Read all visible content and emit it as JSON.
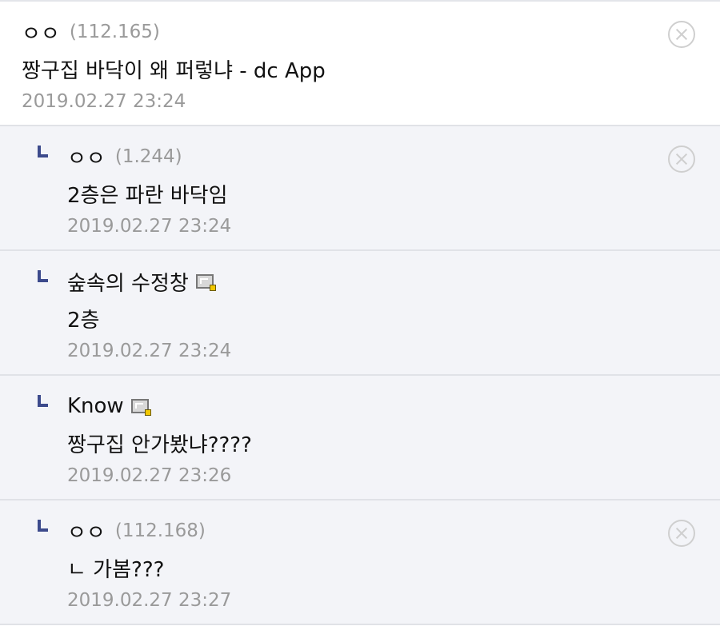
{
  "comments": [
    {
      "author": "ㅇㅇ",
      "ip": "(112.165)",
      "text": "짱구집 바닥이 왜 퍼렇냐 - dc App",
      "date": "2019.02.27 23:24",
      "is_reply": false,
      "has_delete": true,
      "has_gallog_icon": false
    },
    {
      "author": "ㅇㅇ",
      "ip": "(1.244)",
      "text": "2층은 파란 바닥임",
      "date": "2019.02.27 23:24",
      "is_reply": true,
      "has_delete": true,
      "has_gallog_icon": false
    },
    {
      "author": "숲속의 수정창",
      "ip": "",
      "text": "2층",
      "date": "2019.02.27 23:24",
      "is_reply": true,
      "has_delete": false,
      "has_gallog_icon": true
    },
    {
      "author": "Know",
      "ip": "",
      "text": "짱구집 안가봤냐????",
      "date": "2019.02.27 23:26",
      "is_reply": true,
      "has_delete": false,
      "has_gallog_icon": true
    },
    {
      "author": "ㅇㅇ",
      "ip": "(112.168)",
      "text": "ㄴ 가봄???",
      "date": "2019.02.27 23:27",
      "is_reply": true,
      "has_delete": true,
      "has_gallog_icon": false
    }
  ],
  "icons": {
    "reply": "reply-arrow-icon",
    "delete": "close-circle-icon",
    "gallog": "gallog-icon"
  },
  "colors": {
    "reply_background": "#f3f4f8",
    "reply_marker": "#3c4a8c",
    "meta_text": "#9a9a9a"
  }
}
